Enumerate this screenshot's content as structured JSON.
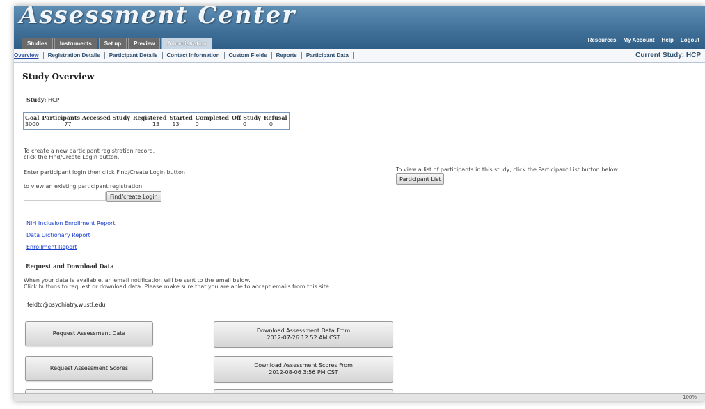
{
  "app": {
    "title": "Assessment Center"
  },
  "tabs": [
    "Studies",
    "Instruments",
    "Set up",
    "Preview",
    "Administration"
  ],
  "toplinks": [
    "Resources",
    "My Account",
    "Help",
    "Logout"
  ],
  "subnav": [
    "Overview",
    "Registration Details",
    "Participant Details",
    "Contact Information",
    "Custom Fields",
    "Reports",
    "Participant Data"
  ],
  "current_study": "Current Study: HCP",
  "page": {
    "title": "Study Overview",
    "study_label": "Study:",
    "study_value": "HCP"
  },
  "stats": {
    "headers": [
      "Goal",
      "Participants Accessed Study",
      "Registered",
      "Started",
      "Completed",
      "Off Study",
      "Refusal"
    ],
    "values": [
      "3000",
      "77",
      "13",
      "13",
      "0",
      "0",
      "0"
    ]
  },
  "instructions": {
    "line1": "To create a new participant registration record,",
    "line2": "click the Find/Create Login button.",
    "line3": "Enter participant login then click Find/Create Login button",
    "line4": "to view an existing participant registration.",
    "find_button": "Find/create Login",
    "list_text": "To view a list of participants in this study, click the Participant List button below.",
    "list_button": "Participant List"
  },
  "reports": [
    "NIH Inclusion Enrollment Report",
    "Data Dictionary Report",
    "Enrollment Report"
  ],
  "download": {
    "title": "Request and Download Data",
    "note1": "When your data is available, an email notification will be sent to the email below.",
    "note2": "Click buttons to request or download data. Please make sure that you are able to accept emails from this site.",
    "email": "feldtc@psychiatry.wustl.edu",
    "req_data": "Request Assessment Data",
    "dl_data_1": "Download Assessment Data From",
    "dl_data_2": "2012-07-26 12:52 AM CST",
    "req_scores": "Request Assessment Scores",
    "dl_scores_1": "Download Assessment Scores From",
    "dl_scores_2": "2012-08-06 3:56 PM CST"
  },
  "status": {
    "zoom": "100%"
  }
}
